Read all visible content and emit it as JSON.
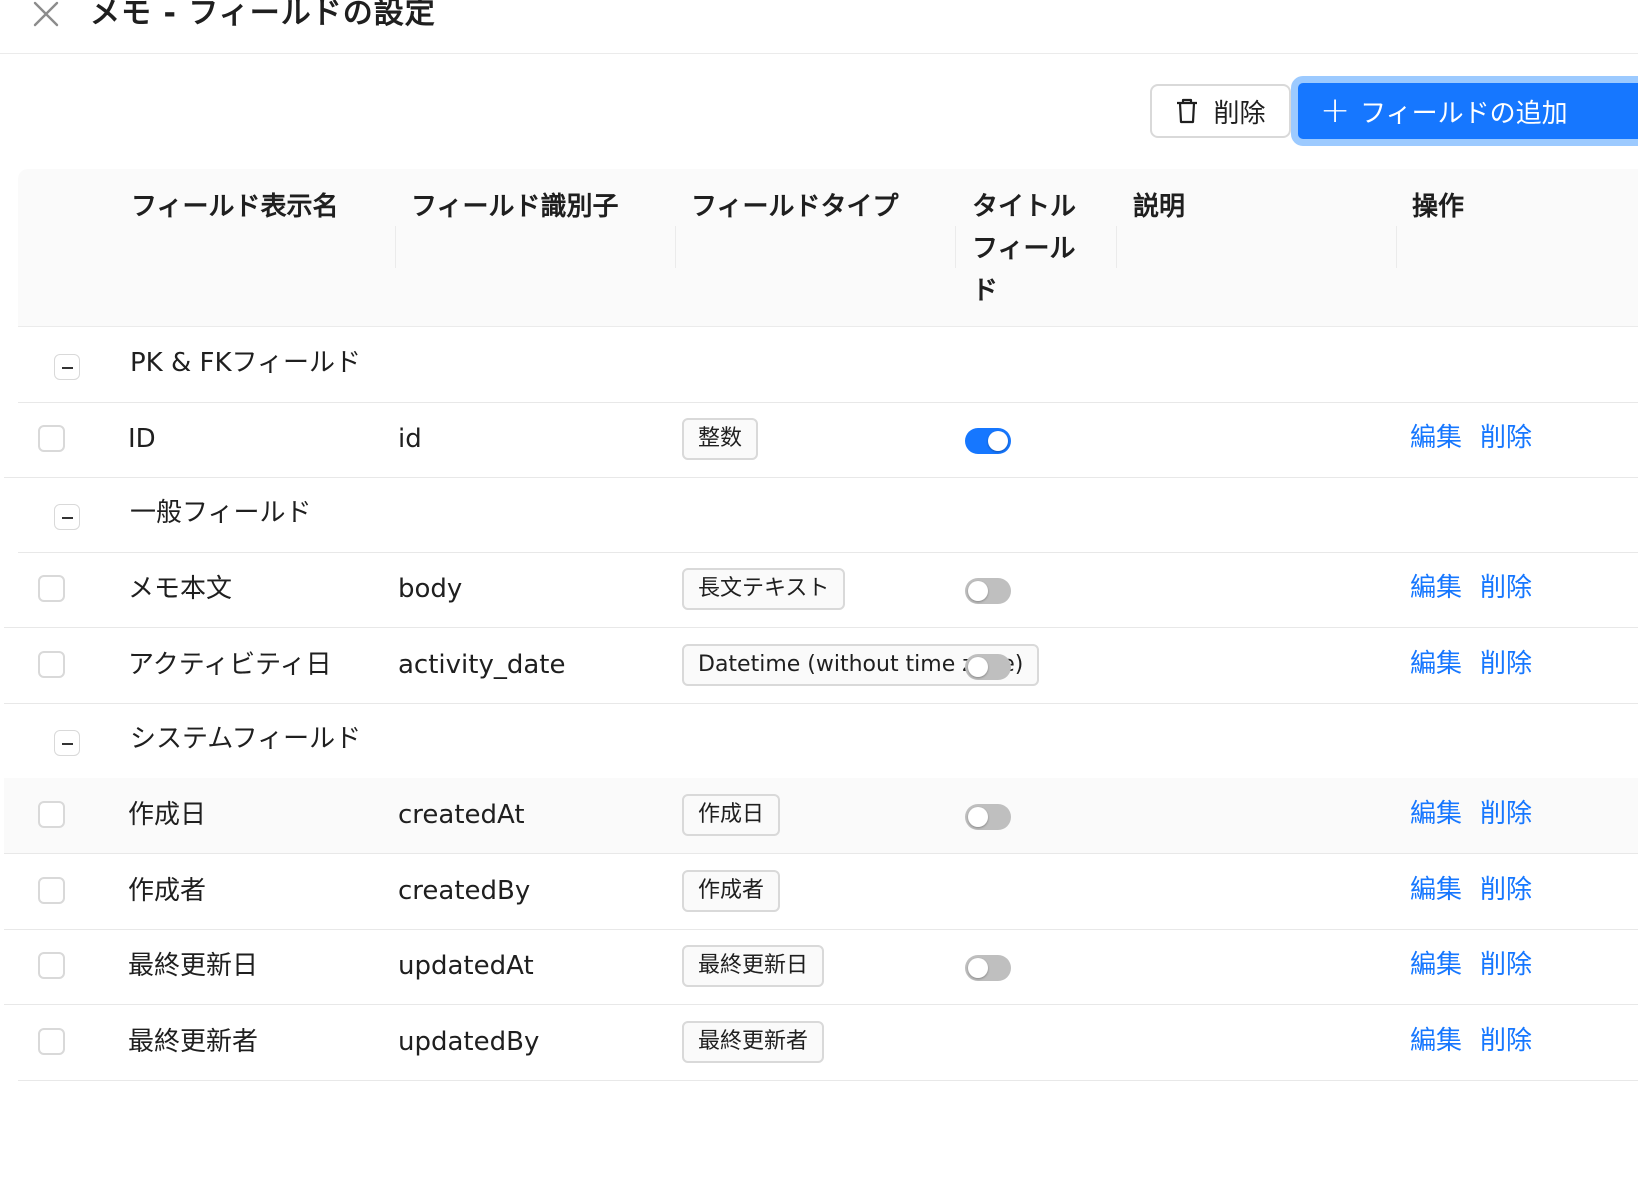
{
  "drawer": {
    "title": "メモ - フィールドの設定"
  },
  "toolbar": {
    "delete_label": "削除",
    "add_label": "フィールドの追加"
  },
  "table": {
    "columns": {
      "display_name": "フィールド表示名",
      "identifier": "フィールド識別子",
      "type": "フィールドタイプ",
      "title_field_line1": "タイトル",
      "title_field_line2": "フィール",
      "title_field_line3": "ド",
      "description": "説明",
      "actions": "操作"
    },
    "groups": [
      {
        "label": "PK & FKフィールド",
        "expanded": true
      },
      {
        "label": "一般フィールド",
        "expanded": true
      },
      {
        "label": "システムフィールド",
        "expanded": true
      }
    ],
    "rows": [
      {
        "name": "ID",
        "identifier": "id",
        "type": "整数",
        "title_field": true,
        "edit": "編集",
        "delete": "削除"
      },
      {
        "name": "メモ本文",
        "identifier": "body",
        "type": "長文テキスト",
        "title_field": false,
        "edit": "編集",
        "delete": "削除"
      },
      {
        "name": "アクティビティ日",
        "identifier": "activity_date",
        "type": "Datetime (without time zone)",
        "title_field": false,
        "edit": "編集",
        "delete": "削除"
      },
      {
        "name": "作成日",
        "identifier": "createdAt",
        "type": "作成日",
        "title_field": false,
        "edit": "編集",
        "delete": "削除"
      },
      {
        "name": "作成者",
        "identifier": "createdBy",
        "type": "作成者",
        "title_field": null,
        "edit": "編集",
        "delete": "削除"
      },
      {
        "name": "最終更新日",
        "identifier": "updatedAt",
        "type": "最終更新日",
        "title_field": false,
        "edit": "編集",
        "delete": "削除"
      },
      {
        "name": "最終更新者",
        "identifier": "updatedBy",
        "type": "最終更新者",
        "title_field": null,
        "edit": "編集",
        "delete": "削除"
      }
    ]
  },
  "colors": {
    "primary": "#1677ff",
    "primary_ring": "#9ccaff",
    "border": "#d9d9d9",
    "switch_off": "#bfbfbf"
  }
}
